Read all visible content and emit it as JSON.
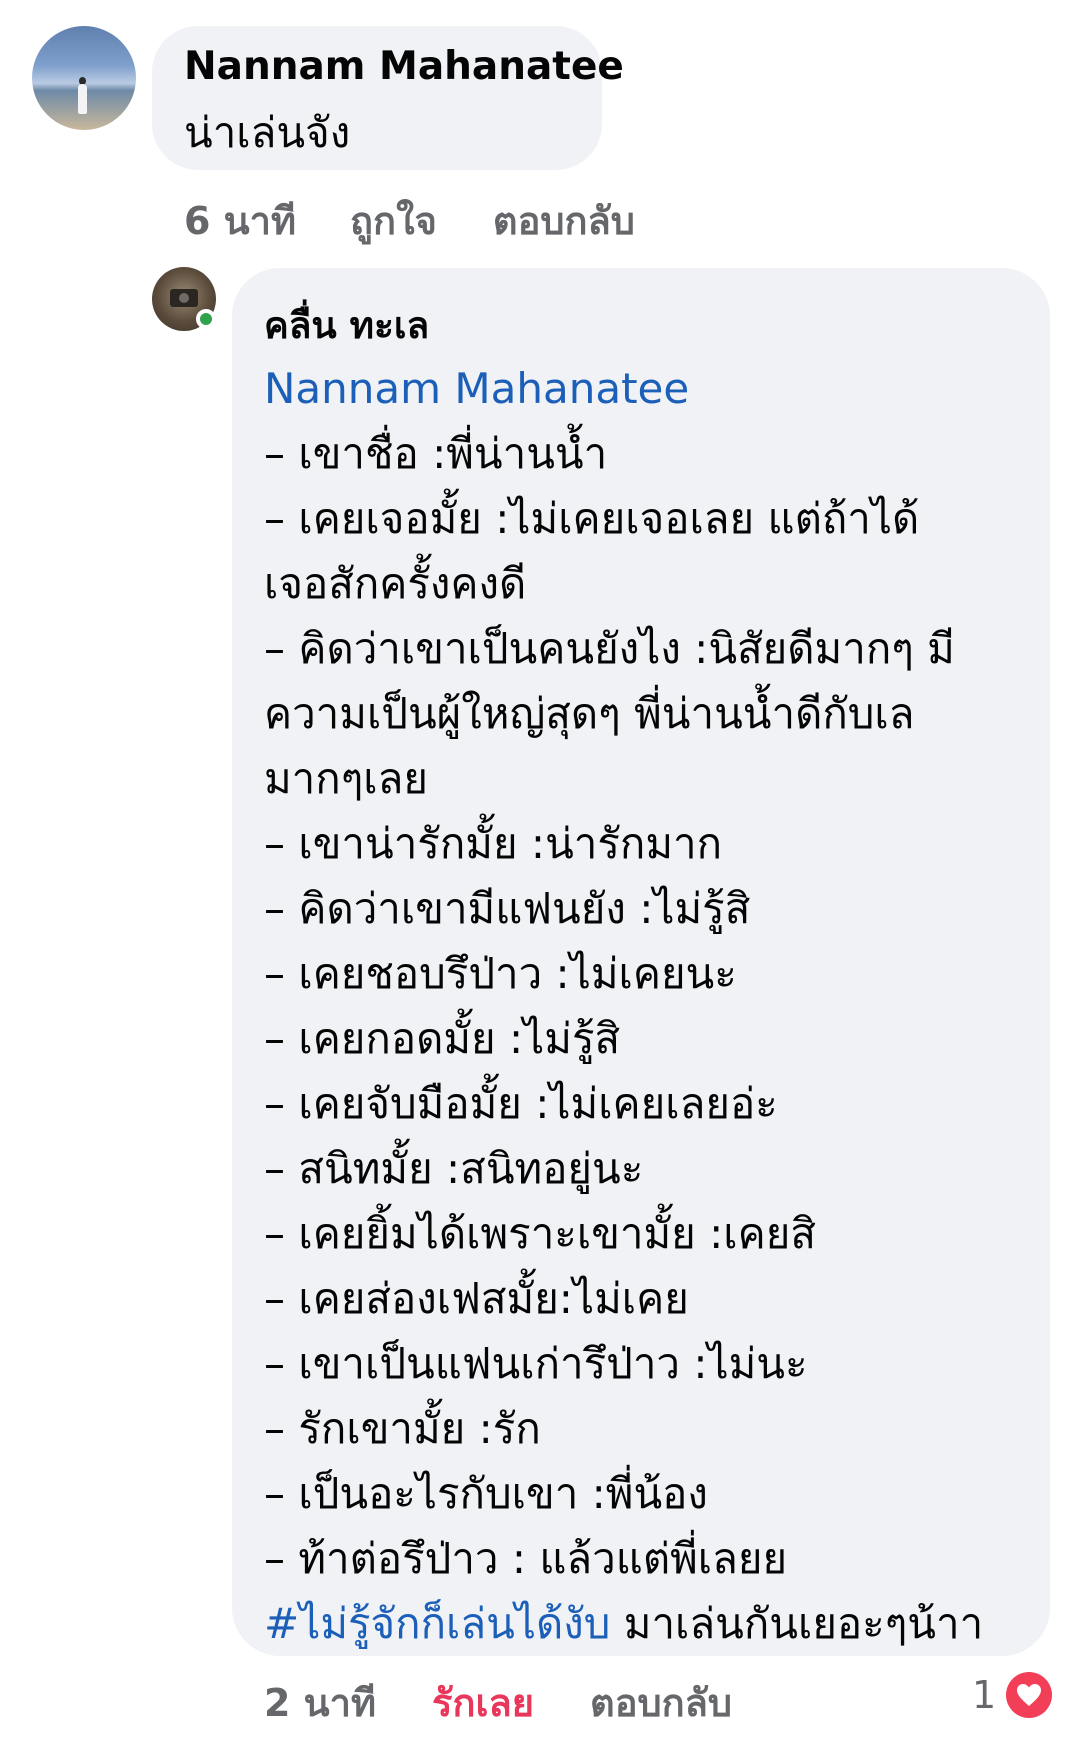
{
  "comment": {
    "author": "Nannam Mahanatee",
    "text": "น่าเล่นจัง",
    "time": "6 นาที",
    "like_label": "ถูกใจ",
    "reply_label": "ตอบกลับ"
  },
  "reply": {
    "author": "คลื่น ทะเล",
    "mention": "Nannam Mahanatee",
    "lines": [
      "– เขาชื่อ :พี่น่านน้ำ",
      " – เคยเจอมั้ย :ไม่เคยเจอเลย แต่ถ้าได้",
      "เจอสักครั้งคงดี",
      " – คิดว่าเขาเป็นคนยังไง :นิสัยดีมากๆ มี",
      "ความเป็นผู้ใหญ่สุดๆ พี่น่านน้ำดีกับเล",
      "มากๆเลย",
      " – เขาน่ารักมั้ย :น่ารักมาก",
      " – คิดว่าเขามีแฟนยัง :ไม่รู้สิ",
      " – เคยชอบรึป่าว :ไม่เคยนะ",
      " – เคยกอดมั้ย :ไม่รู้สิ",
      " – เคยจับมือมั้ย :ไม่เคยเลยอ่ะ",
      " – สนิทมั้ย :สนิทอยู่นะ",
      " – เคยยิ้มได้เพราะเขามั้ย :เคยสิ",
      " – เคยส่องเฟสมั้ย:ไม่เคย",
      " – เขาเป็นแฟนเก่ารึป่าว :ไม่นะ",
      " – รักเขามั้ย :รัก",
      " – เป็นอะไรกับเขา :พี่น้อง",
      " – ท้าต่อรึป่าว : แล้วแต่พี่เลยย"
    ],
    "hashtag": "#ไม่รู้จักก็เล่นได้งับ",
    "closing": " มาเล่นกันเยอะๆน้าา",
    "time": "2 นาที",
    "like_label": "รักเลย",
    "reply_label": "ตอบกลับ",
    "reaction_count": "1",
    "reaction_icon": "heart-icon",
    "reaction_color": "#f33e58",
    "like_color": "#e8375a",
    "link_color": "#1b5fb8"
  }
}
